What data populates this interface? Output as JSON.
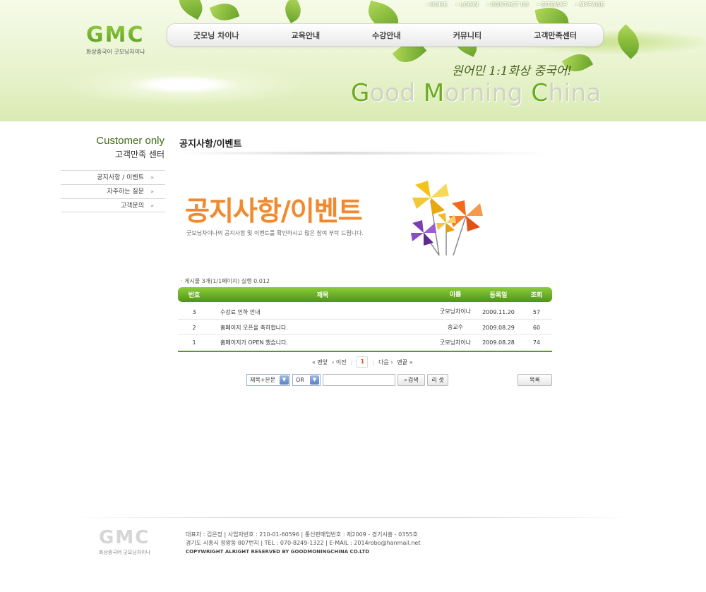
{
  "header": {
    "top_links": [
      "HOME",
      "LOGIN",
      "CONTACT US",
      "SITEMAP",
      "MYPAGE"
    ],
    "logo_mark": "GMC",
    "logo_sub": "화상중국어 굿모닝차이나",
    "nav": [
      "굿모닝 차이나",
      "교육안내",
      "수강안내",
      "커뮤니티",
      "고객만족센터"
    ],
    "slogan": "원어민 1:1화상 중국어!",
    "brand_parts": [
      "G",
      "ood ",
      "M",
      "orning ",
      "C",
      "hina"
    ]
  },
  "sidebar": {
    "title_en": "Customer only",
    "title_ko": "고객만족 센터",
    "items": [
      "공지사항 / 이벤트",
      "자주하는 질문",
      "고객문의"
    ]
  },
  "main": {
    "page_title": "공지사항/이벤트",
    "banner_title": "공지사항/이벤트",
    "banner_desc": "굿모닝차이나의 공지사항 및 이벤트를 확인하시고 많은 참여 부탁 드립니다.",
    "count_text": "· 게시물 3개(1/1페이지) 실행 0.012",
    "table": {
      "headers": [
        "번호",
        "제목",
        "이름",
        "등록일",
        "조회"
      ],
      "rows": [
        {
          "no": "3",
          "title": "수강료 인하 안내",
          "name": "굿모닝차이나",
          "date": "2009.11.20",
          "views": "57"
        },
        {
          "no": "2",
          "title": "홈페이지 오픈을 축하합니다.",
          "name": "송교수",
          "date": "2009.08.29",
          "views": "60"
        },
        {
          "no": "1",
          "title": "홈페이지가 OPEN 했습니다.",
          "name": "굿모닝차이나",
          "date": "2009.08.28",
          "views": "74"
        }
      ]
    },
    "pager": {
      "first": "맨앞",
      "prev": "이전",
      "current": "1",
      "next": "다음",
      "last": "맨끝"
    },
    "search": {
      "field_select": "제목+본문",
      "op_select": "OR",
      "input_value": "",
      "search_button": "검색",
      "reset_button": "리 셋",
      "list_button": "목록"
    }
  },
  "footer": {
    "logo_mark": "GMC",
    "logo_sub": "화상중국어 굿모닝차이나",
    "line1": "대표자 : 김은정  |  사업자번호 : 210-01-60596  |  통신판매업번호 : 제2009 - 경기시흥 - 0355호",
    "line2": "경기도 시흥시 정왕동 807번지  |  TEL : 070-8249-1322  |  E-MAIL : 2014robo@hanmail.net",
    "copyright": "COPYWRIGHT ALRIGHT RESERVED BY GOODMONINGCHINA CO.LTD"
  },
  "colors": {
    "accent_green": "#5c9a1f",
    "banner_orange": "#f08930",
    "page_number": "#e2531b"
  }
}
